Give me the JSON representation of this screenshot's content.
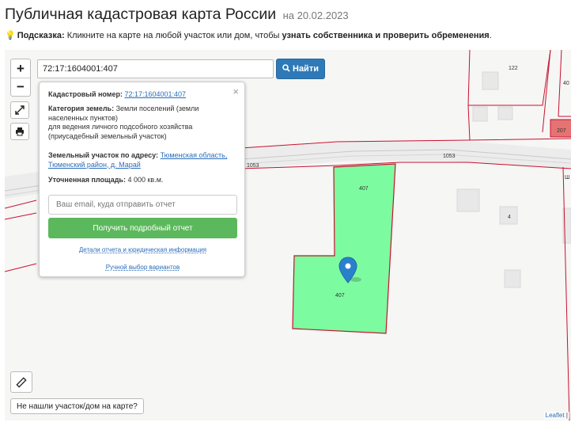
{
  "header": {
    "title": "Публичная кадастровая карта России",
    "date": "на 20.02.2023"
  },
  "hint": {
    "label": "Подсказка:",
    "text": " Кликните на карте на любой участок или дом, чтобы ",
    "bold": "узнать собственника и проверить обременения",
    "end": "."
  },
  "search": {
    "value": "72:17:1604001:407",
    "button": "Найти"
  },
  "zoom": {
    "in": "+",
    "out": "−"
  },
  "popup": {
    "close": "×",
    "cad_label": "Кадастровый номер:",
    "cad_value": "72:17:1604001:407",
    "category_label": "Категория земель:",
    "category_value": "Земли поселений (земли населенных пунктов)",
    "usage": "для ведения личного подсобного хозяйства (приусадебный земельный участок)",
    "address_label": "Земельный участок по адресу:",
    "address_value": "Тюменская область, Тюменский район, д. Марай",
    "area_label": "Уточненная площадь:",
    "area_value": "4 000 кв.м.",
    "email_placeholder": "Ваш email, куда отправить отчет",
    "report_button": "Получить подробный отчет",
    "details_link": "Детали отчета и юридическая информация",
    "manual_link": "Ручной выбор вариантов"
  },
  "map": {
    "labels": {
      "parcel_top": "407",
      "parcel_center": "407",
      "road_left": "1053",
      "road_right": "1053",
      "lot_122": "122",
      "lot_40": "40",
      "lot_207": "207",
      "house_4": "4",
      "edge_ch": "Ш"
    },
    "parcel_color": "#7dfba0",
    "boundary_color": "#c8102e"
  },
  "controls": {
    "not_found": "Не нашли участок/дом на карте?",
    "attribution": "Leaflet",
    "attribution_sep": " |"
  }
}
